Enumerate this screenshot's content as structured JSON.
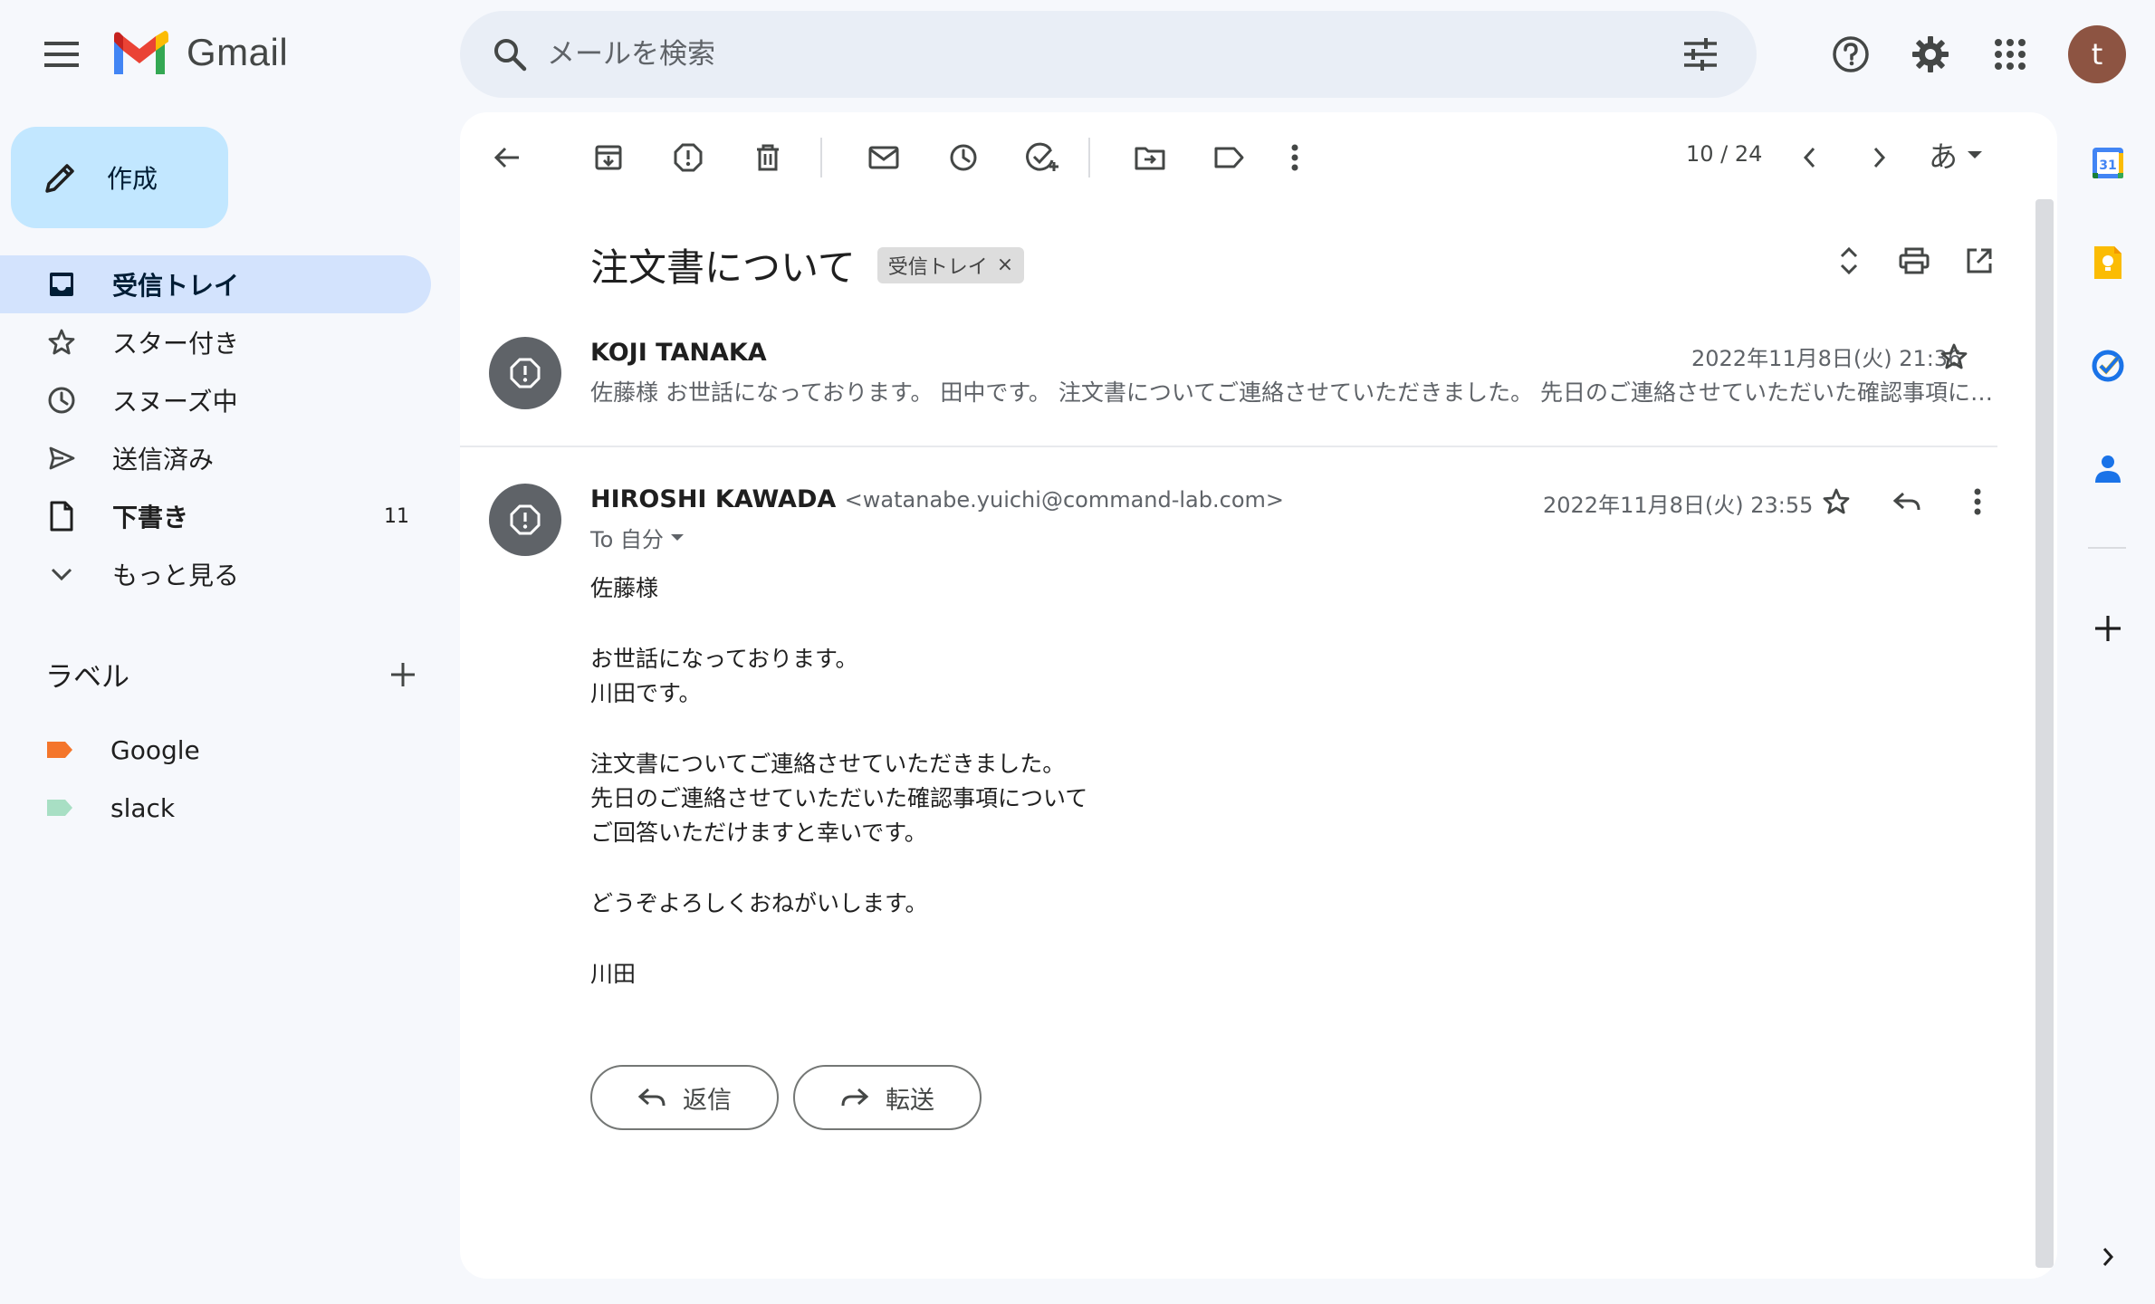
{
  "app": {
    "logo_text": "Gmail",
    "avatar_letter": "t"
  },
  "search": {
    "placeholder": "メールを検索"
  },
  "compose": {
    "label": "作成"
  },
  "nav": {
    "items": [
      {
        "label": "受信トレイ",
        "icon": "inbox-icon",
        "active": true
      },
      {
        "label": "スター付き",
        "icon": "star-icon"
      },
      {
        "label": "スヌーズ中",
        "icon": "clock-icon"
      },
      {
        "label": "送信済み",
        "icon": "send-icon"
      },
      {
        "label": "下書き",
        "icon": "draft-icon",
        "count": "11"
      },
      {
        "label": "もっと見る",
        "icon": "chevron-down-icon"
      }
    ]
  },
  "labels": {
    "heading": "ラベル",
    "items": [
      {
        "name": "Google",
        "color": "#f4762b"
      },
      {
        "name": "slack",
        "color": "#a8dfc4"
      }
    ]
  },
  "toolbar": {
    "pager": "10 / 24",
    "ime": "あ"
  },
  "thread": {
    "subject": "注文書について",
    "tag": "受信トレイ",
    "tag_close": "×",
    "messages": [
      {
        "sender": "KOJI TANAKA",
        "date": "2022年11月8日(火) 21:36",
        "snippet": "佐藤様 お世話になっております。 田中です。 注文書についてご連絡させていただきました。 先日のご連絡させていただいた確認事項についてご回答いただけますと幸いです。"
      },
      {
        "sender": "HIROSHI KAWADA",
        "email": "<watanabe.yuichi@command-lab.com>",
        "date": "2022年11月8日(火) 23:55",
        "to": "To 自分",
        "body": [
          "佐藤様",
          "お世話になっております。",
          "川田です。",
          "注文書についてご連絡させていただきました。",
          "先日のご連絡させていただいた確認事項について",
          "ご回答いただけますと幸いです。",
          "どうぞよろしくおねがいします。",
          "川田"
        ]
      }
    ]
  },
  "actions": {
    "reply": "返信",
    "forward": "転送"
  },
  "colors": {
    "accent": "#0b57d0",
    "compose_bg": "#c2e7ff",
    "active_nav_bg": "#d3e3fd"
  }
}
